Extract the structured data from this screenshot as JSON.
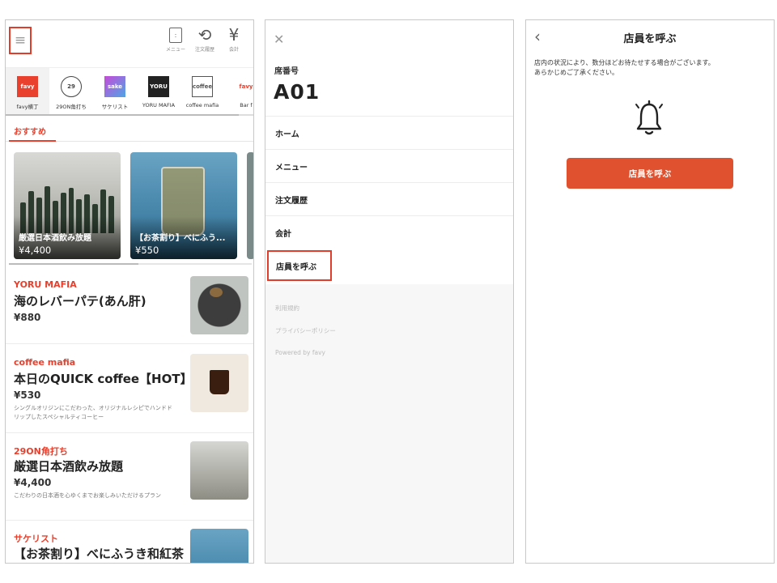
{
  "panel1": {
    "top_icons": [
      {
        "icon": "menu-book-icon",
        "label": "メニュー"
      },
      {
        "icon": "history-icon",
        "label": "注文履歴"
      },
      {
        "icon": "yen-icon",
        "label": "会計"
      }
    ],
    "shops": [
      {
        "logo": "favy",
        "name": "favy横丁"
      },
      {
        "logo": "29",
        "name": "29ON角打ち"
      },
      {
        "logo": "sake",
        "name": "サケリスト"
      },
      {
        "logo": "YORU",
        "name": "YORU MAFIA"
      },
      {
        "logo": "coffee",
        "name": "coffee mafia"
      },
      {
        "logo": "favy",
        "name": "Bar f"
      }
    ],
    "section_tab": "おすすめ",
    "carousel": [
      {
        "name": "厳選日本酒飲み放題",
        "price": "¥4,400"
      },
      {
        "name": "【お茶割り】べにふう...",
        "price": "¥550"
      }
    ],
    "items": [
      {
        "shop": "YORU MAFIA",
        "title": "海のレバーパテ(あん肝)",
        "price": "¥880",
        "desc": ""
      },
      {
        "shop": "coffee mafia",
        "title": "本日のQUICK coffee【HOT】",
        "price": "¥530",
        "desc": "シングルオリジンにこだわった、オリジナルレシピでハンドドリップしたスペシャルティコーヒー"
      },
      {
        "shop": "29ON角打ち",
        "title": "厳選日本酒飲み放題",
        "price": "¥4,400",
        "desc": "こだわりの日本酒を心ゆくまでお楽しみいただけるプラン"
      },
      {
        "shop": "サケリスト",
        "title": "【お茶割り】べにふうき和紅茶",
        "price": "",
        "desc": ""
      }
    ]
  },
  "panel2": {
    "seat_label": "席番号",
    "seat_number": "A01",
    "nav": [
      "ホーム",
      "メニュー",
      "注文履歴",
      "会計",
      "店員を呼ぶ"
    ],
    "footer_links": [
      "利用規約",
      "プライバシーポリシー",
      "Powered by favy"
    ]
  },
  "panel3": {
    "title": "店員を呼ぶ",
    "message_line1": "店内の状況により、数分ほどお待たせする場合がございます。",
    "message_line2": "あらかじめご了承ください。",
    "button": "店員を呼ぶ"
  },
  "colors": {
    "accent": "#e8402d",
    "highlight": "#e03e2d",
    "button": "#e0522f"
  }
}
